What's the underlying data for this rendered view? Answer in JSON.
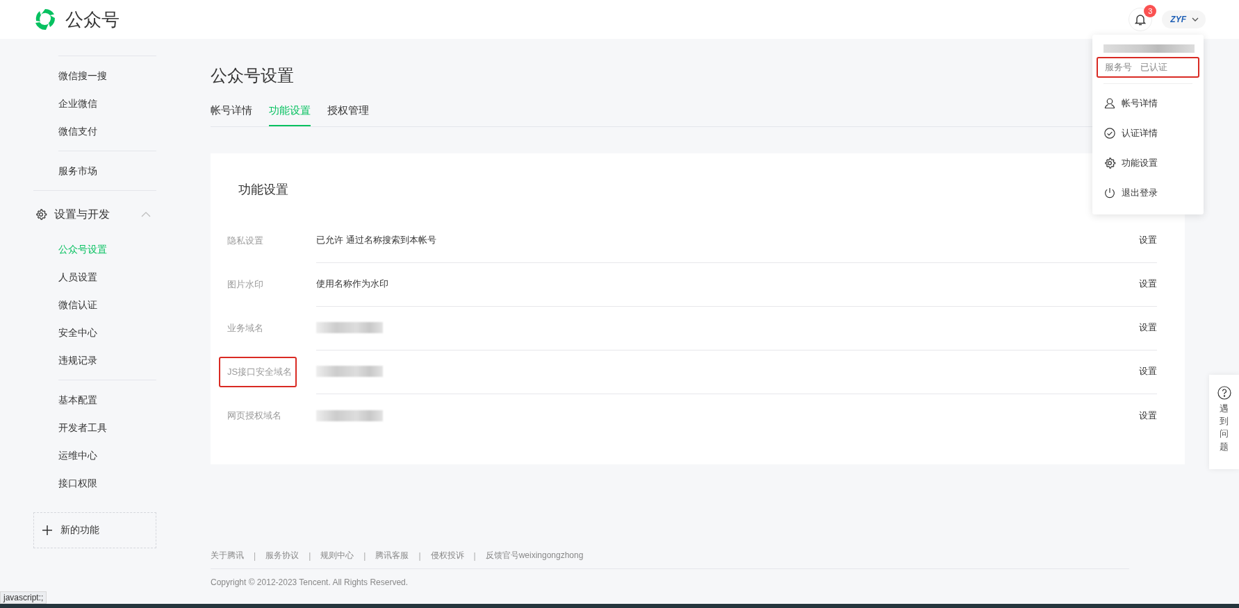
{
  "header": {
    "logo_text": "公众号",
    "notification_count": "3",
    "avatar_text": "ZYF"
  },
  "sidebar": {
    "top_groups": [
      [
        {
          "label": "微信搜一搜",
          "selected": false
        },
        {
          "label": "企业微信",
          "selected": false
        },
        {
          "label": "微信支付",
          "selected": false
        }
      ],
      [
        {
          "label": "服务市场",
          "selected": false
        }
      ]
    ],
    "section": {
      "label": "设置与开发",
      "expanded": true,
      "groups": [
        [
          {
            "label": "公众号设置",
            "selected": true
          },
          {
            "label": "人员设置",
            "selected": false
          },
          {
            "label": "微信认证",
            "selected": false
          },
          {
            "label": "安全中心",
            "selected": false
          },
          {
            "label": "违规记录",
            "selected": false
          }
        ],
        [
          {
            "label": "基本配置",
            "selected": false
          },
          {
            "label": "开发者工具",
            "selected": false
          },
          {
            "label": "运维中心",
            "selected": false
          },
          {
            "label": "接口权限",
            "selected": false
          }
        ]
      ]
    },
    "new_feature": "新的功能"
  },
  "page": {
    "title": "公众号设置",
    "tabs": [
      {
        "label": "帐号详情",
        "selected": false
      },
      {
        "label": "功能设置",
        "selected": true
      },
      {
        "label": "授权管理",
        "selected": false
      }
    ],
    "card": {
      "title": "功能设置",
      "rows": [
        {
          "label": "隐私设置",
          "value": "已允许 通过名称搜索到本帐号",
          "redacted": false,
          "highlighted": false,
          "action": "设置"
        },
        {
          "label": "图片水印",
          "value": "使用名称作为水印",
          "redacted": false,
          "highlighted": false,
          "action": "设置"
        },
        {
          "label": "业务域名",
          "redacted": true,
          "highlighted": false,
          "action": "设置"
        },
        {
          "label": "JS接口安全域名",
          "redacted": true,
          "highlighted": true,
          "action": "设置"
        },
        {
          "label": "网页授权域名",
          "redacted": true,
          "highlighted": false,
          "action": "设置"
        }
      ]
    }
  },
  "dropdown": {
    "name_redacted": true,
    "account_type": "服务号",
    "status": "已认证",
    "highlighted": true,
    "items": [
      {
        "label": "帐号详情",
        "kind": "person"
      },
      {
        "label": "认证详情",
        "kind": "check"
      },
      {
        "label": "功能设置",
        "kind": "gear"
      },
      {
        "label": "退出登录",
        "kind": "power"
      }
    ]
  },
  "help": {
    "label": "遇到问题"
  },
  "footer": {
    "separator": "|",
    "links": [
      "关于腾讯",
      "服务协议",
      "规则中心",
      "腾讯客服",
      "侵权投诉",
      "反馈官号weixingongzhong"
    ],
    "copyright": "Copyright © 2012-2023 Tencent. All Rights Reserved."
  },
  "status_tip": "javascript:;"
}
